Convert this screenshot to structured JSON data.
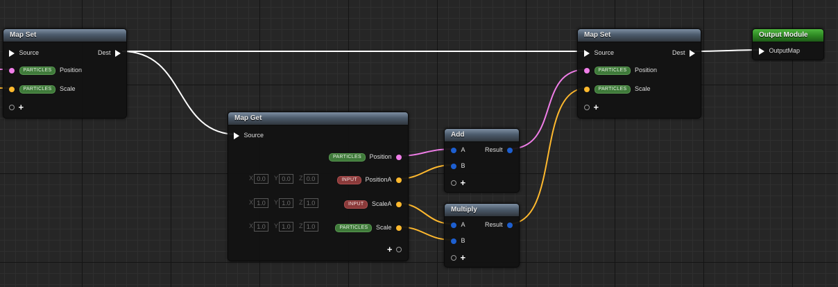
{
  "nodes": {
    "map_set_1": {
      "title": "Map Set",
      "source_label": "Source",
      "dest_label": "Dest",
      "position": {
        "badge": "PARTICLES",
        "label": "Position"
      },
      "scale": {
        "badge": "PARTICLES",
        "label": "Scale"
      }
    },
    "map_get": {
      "title": "Map Get",
      "source_label": "Source",
      "position": {
        "badge": "PARTICLES",
        "label": "Position"
      },
      "position_a": {
        "badge": "INPUT",
        "label": "PositionA",
        "x": "0.0",
        "y": "0.0",
        "z": "0.0"
      },
      "scale_a": {
        "badge": "INPUT",
        "label": "ScaleA",
        "x": "1.0",
        "y": "1.0",
        "z": "1.0"
      },
      "scale": {
        "badge": "PARTICLES",
        "label": "Scale",
        "x": "1.0",
        "y": "1.0",
        "z": "1.0"
      },
      "axis_x": "X",
      "axis_y": "Y",
      "axis_z": "Z"
    },
    "add": {
      "title": "Add",
      "a_label": "A",
      "b_label": "B",
      "result_label": "Result"
    },
    "multiply": {
      "title": "Multiply",
      "a_label": "A",
      "b_label": "B",
      "result_label": "Result"
    },
    "map_set_2": {
      "title": "Map Set",
      "source_label": "Source",
      "dest_label": "Dest",
      "position": {
        "badge": "PARTICLES",
        "label": "Position"
      },
      "scale": {
        "badge": "PARTICLES",
        "label": "Scale"
      }
    },
    "output_module": {
      "title": "Output Module",
      "output_label": "OutputMap"
    }
  },
  "colors": {
    "exec_wire": "#ffffff",
    "position_wire": "#f07ee8",
    "scale_wire": "#ffb92e",
    "result_pin": "#1d5fd0",
    "particles_badge": "#3f7a3a",
    "input_badge": "#8a3a3a",
    "output_header": "#2e8a23"
  },
  "icons": [
    "exec-pin-icon",
    "position-pin-icon",
    "scale-pin-icon",
    "add-pin-plus-icon",
    "result-pin-icon"
  ]
}
